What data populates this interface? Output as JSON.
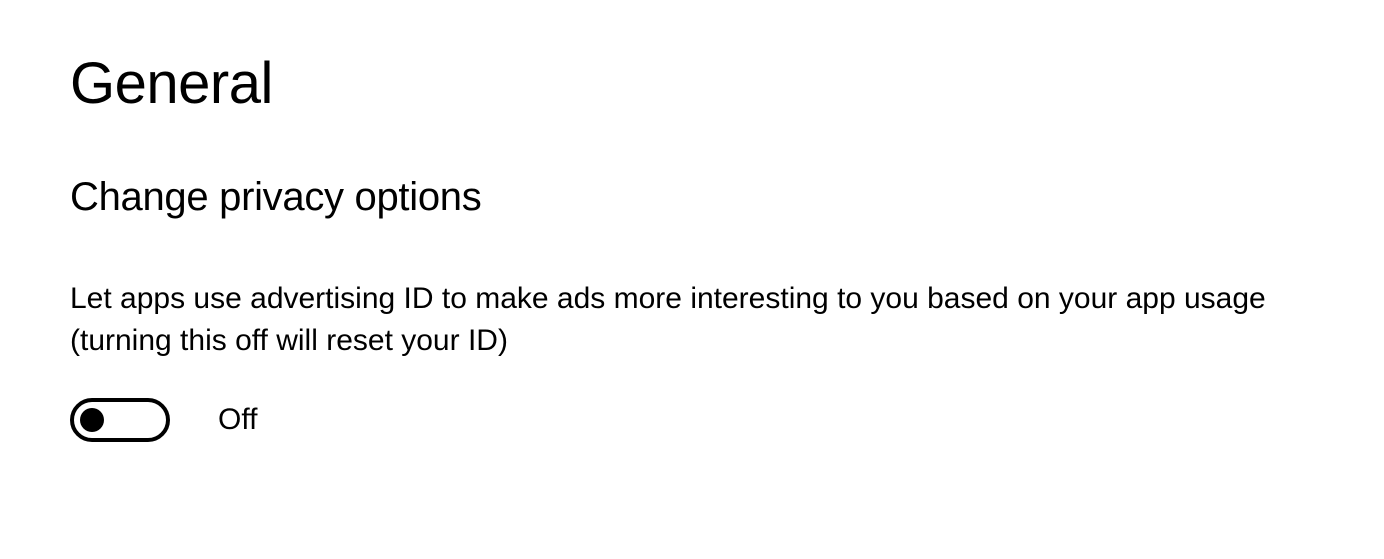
{
  "page": {
    "title": "General"
  },
  "section": {
    "heading": "Change privacy options"
  },
  "settings": {
    "advertising_id": {
      "description": "Let apps use advertising ID to make ads more interesting to you based on your app usage (turning this off will reset your ID)",
      "state_label": "Off",
      "state": false
    }
  }
}
